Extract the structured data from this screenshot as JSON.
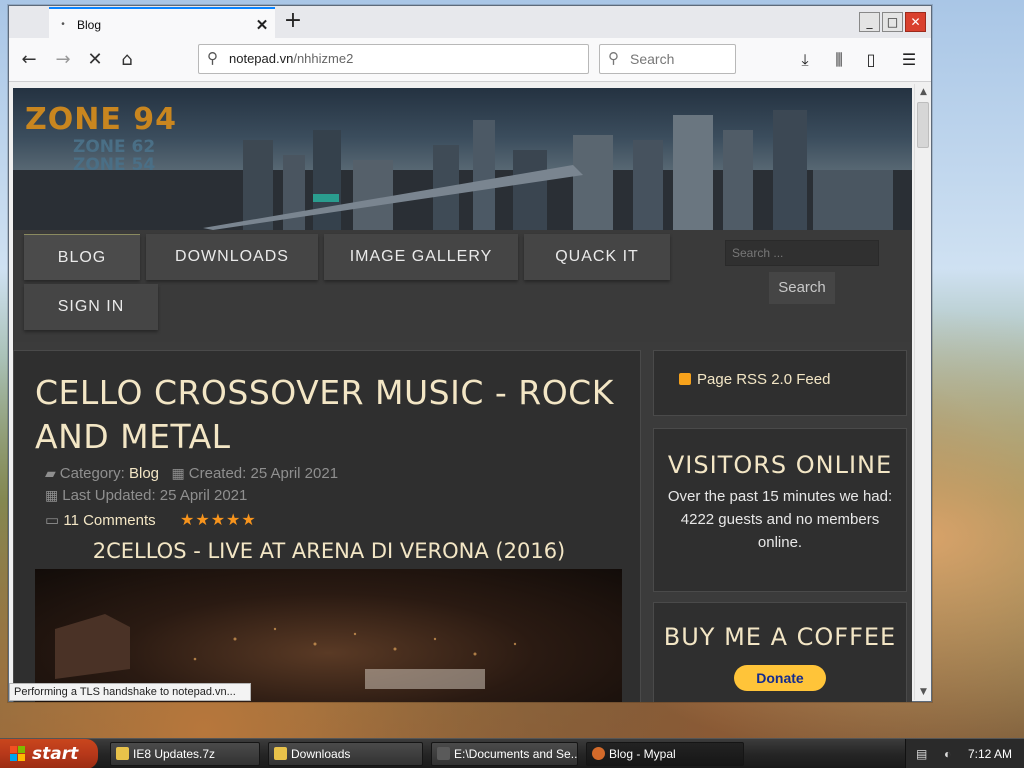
{
  "browser": {
    "tab_title": "Blog",
    "tab_close": "✕",
    "new_tab": "+",
    "url_host": "notepad.vn",
    "url_rest": "/nhhizme2",
    "search_placeholder": "Search",
    "status_text": "Performing a TLS handshake to notepad.vn..."
  },
  "site": {
    "logo_lines": [
      "ZONE 94",
      "ZONE 62",
      "ZONE 54"
    ],
    "menu": [
      "BLOG",
      "DOWNLOADS",
      "IMAGE GALLERY",
      "QUACK IT",
      "SIGN IN"
    ],
    "search_placeholder": "Search ...",
    "search_button": "Search"
  },
  "article": {
    "title": "CELLO CROSSOVER MUSIC - ROCK AND METAL",
    "category_label": "Category:",
    "category": "Blog",
    "created": "Created: 25 April 2021",
    "updated": "Last Updated: 25 April 2021",
    "comments": "11 Comments",
    "rating": 5,
    "video_title": "2CELLOS - LIVE AT ARENA DI VERONA (2016)"
  },
  "sidebar": {
    "rss": "Page RSS 2.0 Feed",
    "visitors_title": "VISITORS ONLINE",
    "visitors_body": "Over the past 15 minutes we had: 4222 guests and no members online.",
    "coffee_title": "BUY ME A COFFEE",
    "donate": "Donate"
  },
  "taskbar": {
    "start": "start",
    "tasks": [
      {
        "label": "IE8 Updates.7z",
        "color": "#e8c24a"
      },
      {
        "label": "Downloads",
        "color": "#e8c24a"
      },
      {
        "label": "E:\\Documents and Se...",
        "color": "#5a5a5a"
      },
      {
        "label": "Blog - Mypal",
        "color": "#d36a2a"
      }
    ],
    "clock": "7:12 AM"
  },
  "colors": {
    "accent": "#f3e6c5",
    "star": "#f7941d",
    "tab_indicator": "#0a84ff"
  }
}
